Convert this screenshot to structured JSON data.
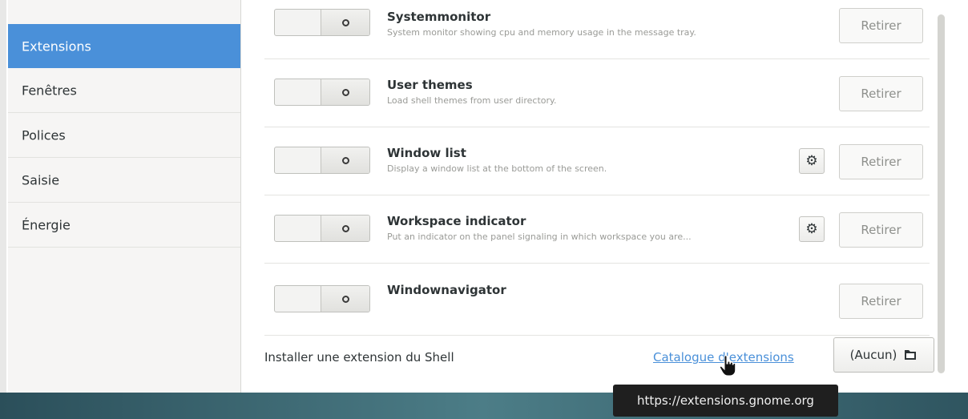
{
  "sidebar": {
    "items": [
      {
        "label": "Extensions",
        "active": true
      },
      {
        "label": "Fenêtres"
      },
      {
        "label": "Polices"
      },
      {
        "label": "Saisie"
      },
      {
        "label": "Énergie"
      }
    ]
  },
  "extensions": [
    {
      "name": "Systemmonitor",
      "description": "System monitor showing cpu and memory usage in the message tray.",
      "enabled": false,
      "has_settings": false,
      "remove_label": "Retirer"
    },
    {
      "name": "User themes",
      "description": "Load shell themes from user directory.",
      "enabled": false,
      "has_settings": false,
      "remove_label": "Retirer"
    },
    {
      "name": "Window list",
      "description": "Display a window list at the bottom of the screen.",
      "enabled": false,
      "has_settings": true,
      "remove_label": "Retirer"
    },
    {
      "name": "Workspace indicator",
      "description": "Put an indicator on the panel signaling in which workspace you are...",
      "enabled": false,
      "has_settings": true,
      "remove_label": "Retirer"
    },
    {
      "name": "Windownavigator",
      "description": "",
      "enabled": false,
      "has_settings": false,
      "remove_label": "Retirer"
    }
  ],
  "footer": {
    "install_label": "Installer une extension du Shell",
    "catalog_link": "Catalogue d'extensions",
    "file_button": "(Aucun)"
  },
  "tooltip": {
    "text": "https://extensions.gnome.org"
  },
  "colors": {
    "accent": "#4a90d9",
    "link": "#4a90d9",
    "tooltip_bg": "#1f1f1f"
  }
}
